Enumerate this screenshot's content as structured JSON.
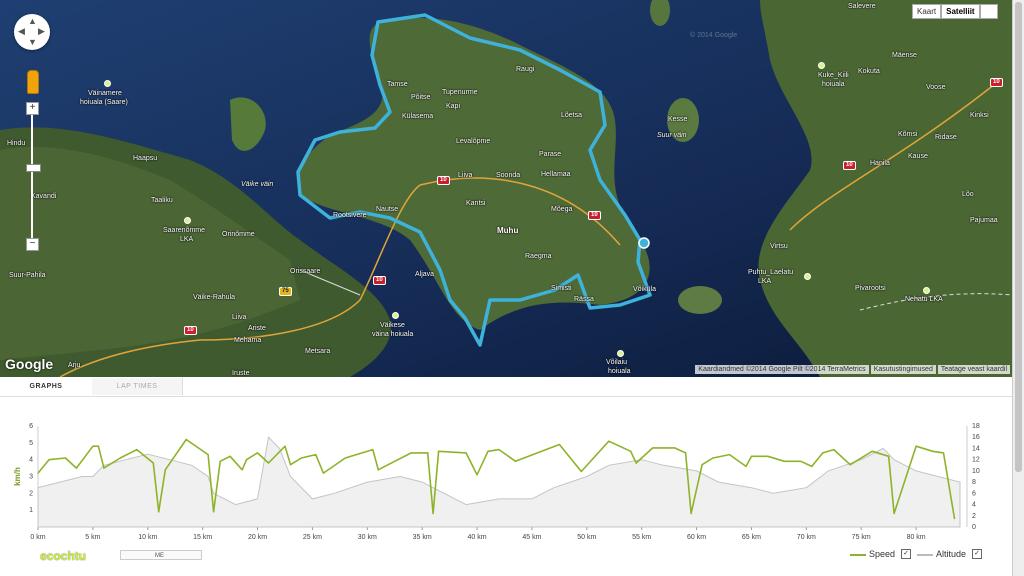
{
  "map": {
    "maptype": {
      "map_label": "Kaart",
      "satellite_label": "Satelliit"
    },
    "google_logo": "Google",
    "attribution": [
      "Kaardiandmed ©2014 Google Pilt ©2014 TerraMetrics",
      "Kasutustingimused",
      "Teatage veast kaardil"
    ],
    "labels": {
      "salevere": "Salevere",
      "maense": "Mäense",
      "kuke": "Kuke_Kiili",
      "hoiuala1": "hoiuala",
      "kokuta": "Kokuta",
      "voose": "Voose",
      "kinksi": "Kinksi",
      "komsi": "Kõmsi",
      "ridase": "Ridase",
      "hanila": "Hanila",
      "kause": "Kause",
      "loo": "Lõo",
      "pajumaa": "Pajumaa",
      "virtsu": "Virtsu",
      "puhtu": "Puhtu_Laelatu",
      "lka": "LKA",
      "pivarootsi": "Pivarootsi",
      "nehatu": "Nehatu LKA",
      "kesse": "Kesse",
      "suurvain": "Suur väin",
      "raugi": "Raugi",
      "tamse": "Tamse",
      "poitse": "Põitse",
      "tupenurme": "Tupenurme",
      "kapi": "Kapi",
      "kulasema": "Külasema",
      "loetsa": "Lõetsa",
      "levalopme": "Levalõpme",
      "parase": "Parase",
      "liiva": "Liiva",
      "soonda": "Soonda",
      "hellamaa": "Hellamaa",
      "kantsi": "Kantsi",
      "moega": "Mõega",
      "nautse": "Nautse",
      "rootsivere": "Rootsivere",
      "muhu": "Muhu",
      "raegma": "Raegma",
      "aljava": "Aljava",
      "simisti": "Simisti",
      "rassa": "Rässa",
      "vokula": "Võiküla",
      "vainamere": "Väinamere",
      "hoiualasaare": "hoiuala (Saare)",
      "hindu": "Hindu",
      "haapsu": "Haapsu",
      "vaikevain": "Väike väin",
      "taaliku": "Taaliku",
      "kavandi": "Kavandi",
      "saarenomme": "Saarenõmme",
      "lka2": "LKA",
      "orinomme": "Orinõmme",
      "suurpahila": "Suur-Pahila",
      "orissaare": "Orissaare",
      "vaikerahula": "Väike-Rahula",
      "liiva2": "Liiva",
      "ariste": "Ariste",
      "mehama": "Mehama",
      "vaikese": "Väikese",
      "vainahoiuala": "väina hoiuala",
      "metsara": "Metsara",
      "arju": "Arju",
      "iruste": "Iruste",
      "voilaiu": "Võilaiu",
      "hoiuala3": "hoiuala",
      "watermark": "© 2014 Google"
    },
    "roads": {
      "r10a": "10",
      "r10b": "10",
      "r10c": "10",
      "r10d": "10",
      "r10e": "10",
      "r10f": "10",
      "r75": "75"
    }
  },
  "tabs": {
    "graphs": "GRAPHS",
    "lap_times": "LAP TIMES"
  },
  "chart": {
    "y_left_label": "km/h",
    "range_label": "ME"
  },
  "legend": {
    "speed": "Speed",
    "altitude": "Altitude"
  },
  "brand": "ecochtu",
  "colors": {
    "speed": "#8db32a",
    "altitude": "#bbbbbb",
    "route": "#3fb2dc"
  },
  "chart_data": {
    "type": "line",
    "x_label_unit": "km",
    "xlim": [
      0,
      84
    ],
    "x_ticks": [
      "0 km",
      "5 km",
      "10 km",
      "15 km",
      "20 km",
      "25 km",
      "30 km",
      "35 km",
      "40 km",
      "45 km",
      "50 km",
      "55 km",
      "60 km",
      "65 km",
      "70 km",
      "75 km",
      "80 km"
    ],
    "y_left": {
      "label": "km/h",
      "range": [
        0,
        6
      ],
      "ticks": [
        "1",
        "2",
        "3",
        "4",
        "5",
        "6"
      ]
    },
    "y_right": {
      "range": [
        0,
        18
      ],
      "ticks": [
        "0",
        "2",
        "4",
        "6",
        "8",
        "10",
        "12",
        "14",
        "16",
        "18"
      ]
    },
    "series": [
      {
        "name": "Speed",
        "axis": "left",
        "x": [
          0,
          1,
          2.5,
          3.5,
          5,
          5.5,
          6,
          7.5,
          9,
          10.5,
          11,
          11.6,
          13.5,
          15.5,
          16,
          16.6,
          17.5,
          18.6,
          19,
          20,
          21,
          22.5,
          23,
          24,
          25.3,
          26,
          28,
          30.5,
          31,
          32.5,
          34,
          35.5,
          36,
          36.5,
          39,
          40,
          41,
          42,
          43.5,
          45.5,
          47.5,
          49.5,
          52,
          54,
          54.5,
          56,
          58,
          59,
          59.5,
          60.5,
          61.5,
          63,
          64.5,
          65,
          66.5,
          68,
          69.5,
          70.5,
          71.5,
          72.5,
          74,
          76,
          77.5,
          78,
          80,
          81.5,
          82.5,
          83.5
        ],
        "y": [
          3.2,
          4,
          4.1,
          3.5,
          4.8,
          4.8,
          3.5,
          4.1,
          4.6,
          3.8,
          0.9,
          3.4,
          5.2,
          4.3,
          0.9,
          3.9,
          4.2,
          3.4,
          4,
          4.4,
          3.8,
          4.8,
          3.7,
          4.1,
          4.3,
          3.2,
          4.1,
          4.6,
          3.4,
          3.9,
          4.4,
          4.4,
          0.8,
          4.5,
          4.4,
          3.1,
          4.5,
          4.6,
          3.9,
          4.4,
          4.9,
          3.3,
          5.1,
          4.5,
          3.8,
          4.7,
          4.7,
          4.4,
          0.8,
          3.7,
          4.1,
          4.3,
          3.6,
          4.2,
          4.2,
          3.9,
          3.9,
          3.6,
          4.4,
          4.6,
          3.7,
          4.5,
          4.2,
          0.8,
          4.8,
          4.5,
          4.4,
          0.5
        ]
      },
      {
        "name": "Altitude",
        "axis": "right",
        "x": [
          0,
          2,
          4,
          5,
          6,
          8,
          10,
          12,
          14,
          15.5,
          16,
          17,
          18,
          20,
          21,
          22,
          23,
          25,
          27,
          30,
          33,
          35,
          37,
          39,
          42,
          45,
          47,
          50,
          52,
          55,
          57,
          60,
          62,
          65,
          67,
          70,
          72,
          75,
          76,
          77,
          78,
          80,
          82,
          84
        ],
        "y": [
          7,
          8,
          9,
          9,
          11,
          12,
          13,
          12,
          11,
          9,
          6,
          5,
          4,
          5,
          16,
          14,
          9,
          5,
          6,
          8,
          9,
          8,
          6,
          4,
          5,
          5,
          7,
          9,
          11,
          12,
          11,
          10,
          8,
          7,
          6,
          7,
          10,
          12,
          13,
          14,
          12,
          10,
          9,
          8
        ]
      }
    ]
  }
}
